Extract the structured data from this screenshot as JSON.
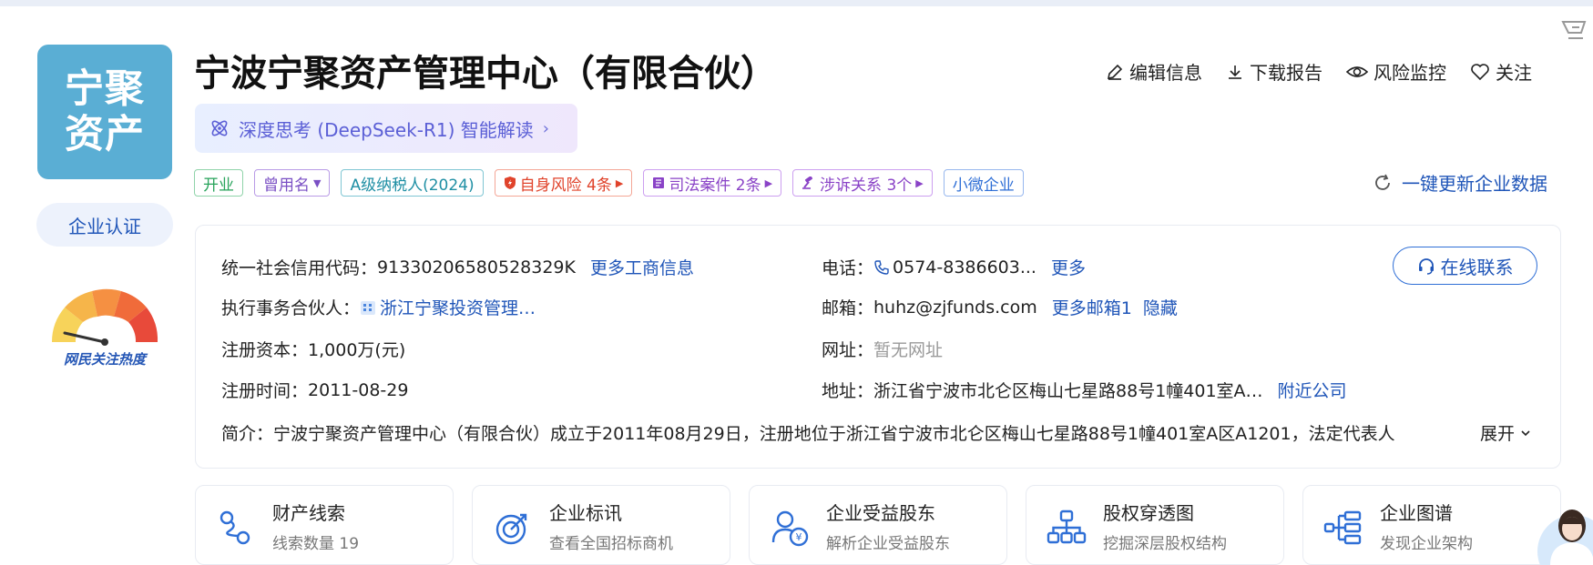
{
  "company": {
    "logo_line1": "宁聚",
    "logo_line2": "资产",
    "name": "宁波宁聚资产管理中心（有限合伙）",
    "cert_label": "企业认证",
    "gauge_label": "网民关注热度"
  },
  "ai": {
    "label": "深度思考 (DeepSeek-R1) 智能解读",
    "chevron": "›"
  },
  "actions": {
    "edit": "编辑信息",
    "download": "下载报告",
    "monitor": "风险监控",
    "follow": "关注"
  },
  "tags": {
    "open": "开业",
    "former": "曾用名",
    "tax": "A级纳税人(2024)",
    "risk": "自身风险 4条",
    "judicial": "司法案件 2条",
    "litigation": "涉诉关系 3个",
    "small": "小微企业"
  },
  "refresh_label": "一键更新企业数据",
  "info": {
    "credit_label": "统一社会信用代码：",
    "credit_value": "91330206580528329K",
    "credit_link": "更多工商信息",
    "partner_label": "执行事务合伙人：",
    "partner_value": "浙江宁聚投资管理…",
    "capital_label": "注册资本：",
    "capital_value": "1,000万(元)",
    "date_label": "注册时间：",
    "date_value": "2011-08-29",
    "phone_label": "电话：",
    "phone_value": "0574-8386603...",
    "phone_more": "更多",
    "email_label": "邮箱：",
    "email_value": "huhz@zjfunds.com",
    "email_more": "更多邮箱1",
    "email_hide": "隐藏",
    "site_label": "网址：",
    "site_value": "暂无网址",
    "addr_label": "地址：",
    "addr_value": "浙江省宁波市北仑区梅山七星路88号1幢401室A…",
    "addr_link": "附近公司",
    "online_label": "在线联系",
    "intro_label": "简介：",
    "intro_value": "宁波宁聚资产管理中心（有限合伙）成立于2011年08月29日，注册地位于浙江省宁波市北仑区梅山七星路88号1幢401室A区A1201，法定代表人",
    "intro_more": "展开"
  },
  "features": [
    {
      "title": "财产线索",
      "sub": "线索数量 19"
    },
    {
      "title": "企业标讯",
      "sub": "查看全国招标商机"
    },
    {
      "title": "企业受益股东",
      "sub": "解析企业受益股东"
    },
    {
      "title": "股权穿透图",
      "sub": "挖掘深层股权结构"
    },
    {
      "title": "企业图谱",
      "sub": "发现企业架构"
    }
  ],
  "colors": {
    "accent": "#1f55b8",
    "logo_bg": "#5aaed4",
    "risk": "#e0432b"
  }
}
